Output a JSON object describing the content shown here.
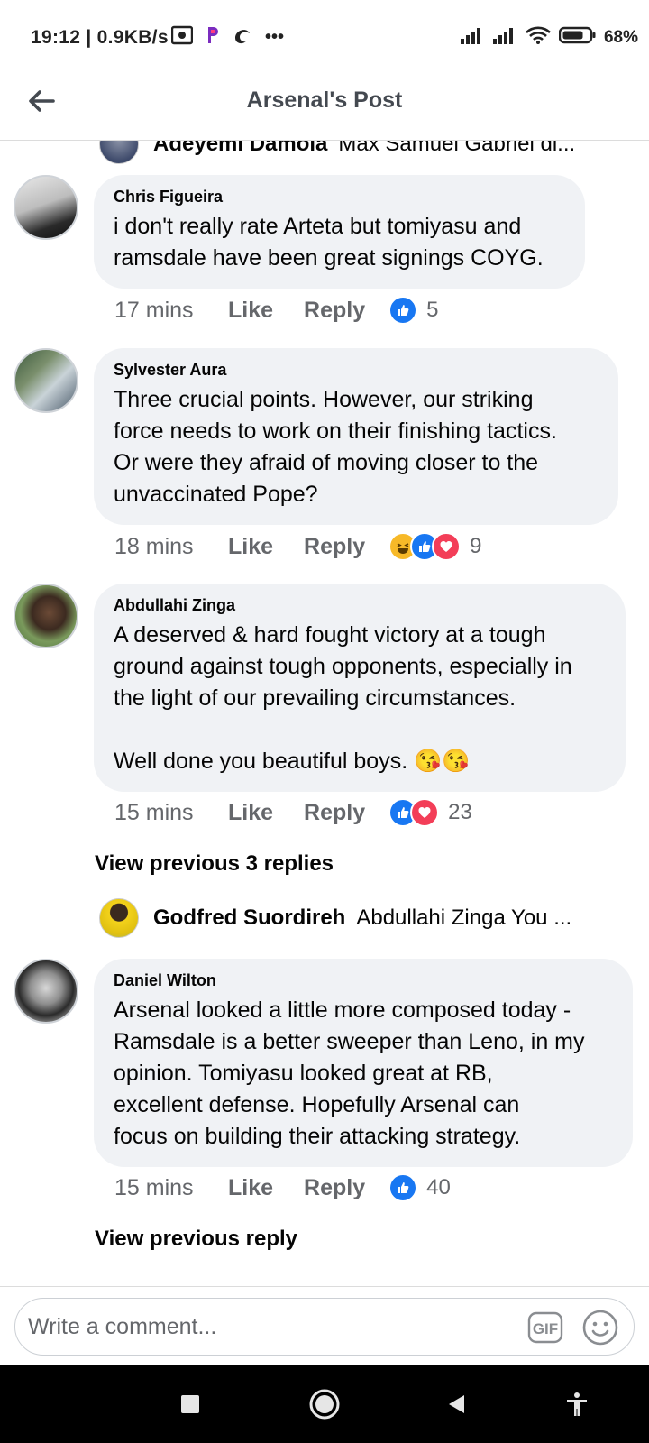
{
  "status_bar": {
    "time": "19:12 | 0.9KB/s",
    "battery": "68%",
    "overflow": "•••"
  },
  "header": {
    "title": "Arsenal's Post"
  },
  "top_reply": {
    "name": "Adeyemi Damola",
    "text": "Max Samuel Gabriel di..."
  },
  "comments": [
    {
      "name": "Chris Figueira",
      "body": "i don't really rate Arteta but tomiyasu and\nramsdale have been great signings COYG.",
      "time": "17 mins",
      "like": "Like",
      "reply": "Reply",
      "reactions": [
        "like"
      ],
      "count": "5"
    },
    {
      "name": "Sylvester Aura",
      "body": "Three crucial points. However, our striking\nforce needs to work on their finishing tactics.\nOr were they afraid of moving closer to the\nunvaccinated Pope?",
      "time": "18 mins",
      "like": "Like",
      "reply": "Reply",
      "reactions": [
        "haha",
        "like",
        "love"
      ],
      "count": "9"
    },
    {
      "name": "Abdullahi Zinga",
      "body": "A deserved & hard fought victory at a tough\nground against tough opponents, especially in\nthe light of our prevailing circumstances.\n\nWell done you beautiful boys. 😘😘",
      "time": "15 mins",
      "like": "Like",
      "reply": "Reply",
      "reactions": [
        "like",
        "love"
      ],
      "count": "23"
    },
    {
      "name": "Daniel Wilton",
      "body": "Arsenal looked a little more composed today -\nRamsdale is a better sweeper than Leno, in my\nopinion. Tomiyasu looked great at RB,\nexcellent defense. Hopefully Arsenal can\nfocus on building their attacking strategy.",
      "time": "15 mins",
      "like": "Like",
      "reply": "Reply",
      "reactions": [
        "like"
      ],
      "count": "40"
    }
  ],
  "view_previous_3": "View previous 3 replies",
  "nested_reply": {
    "name": "Godfred Suordireh",
    "text": "Abdullahi Zinga You ..."
  },
  "view_previous_reply": "View previous reply",
  "composer": {
    "placeholder": "Write a comment...",
    "gif_label": "GIF"
  },
  "colors": {
    "bubble": "#f0f2f5",
    "meta_gray": "#65676b",
    "like_blue": "#1877f2",
    "love_red": "#f33e58"
  }
}
